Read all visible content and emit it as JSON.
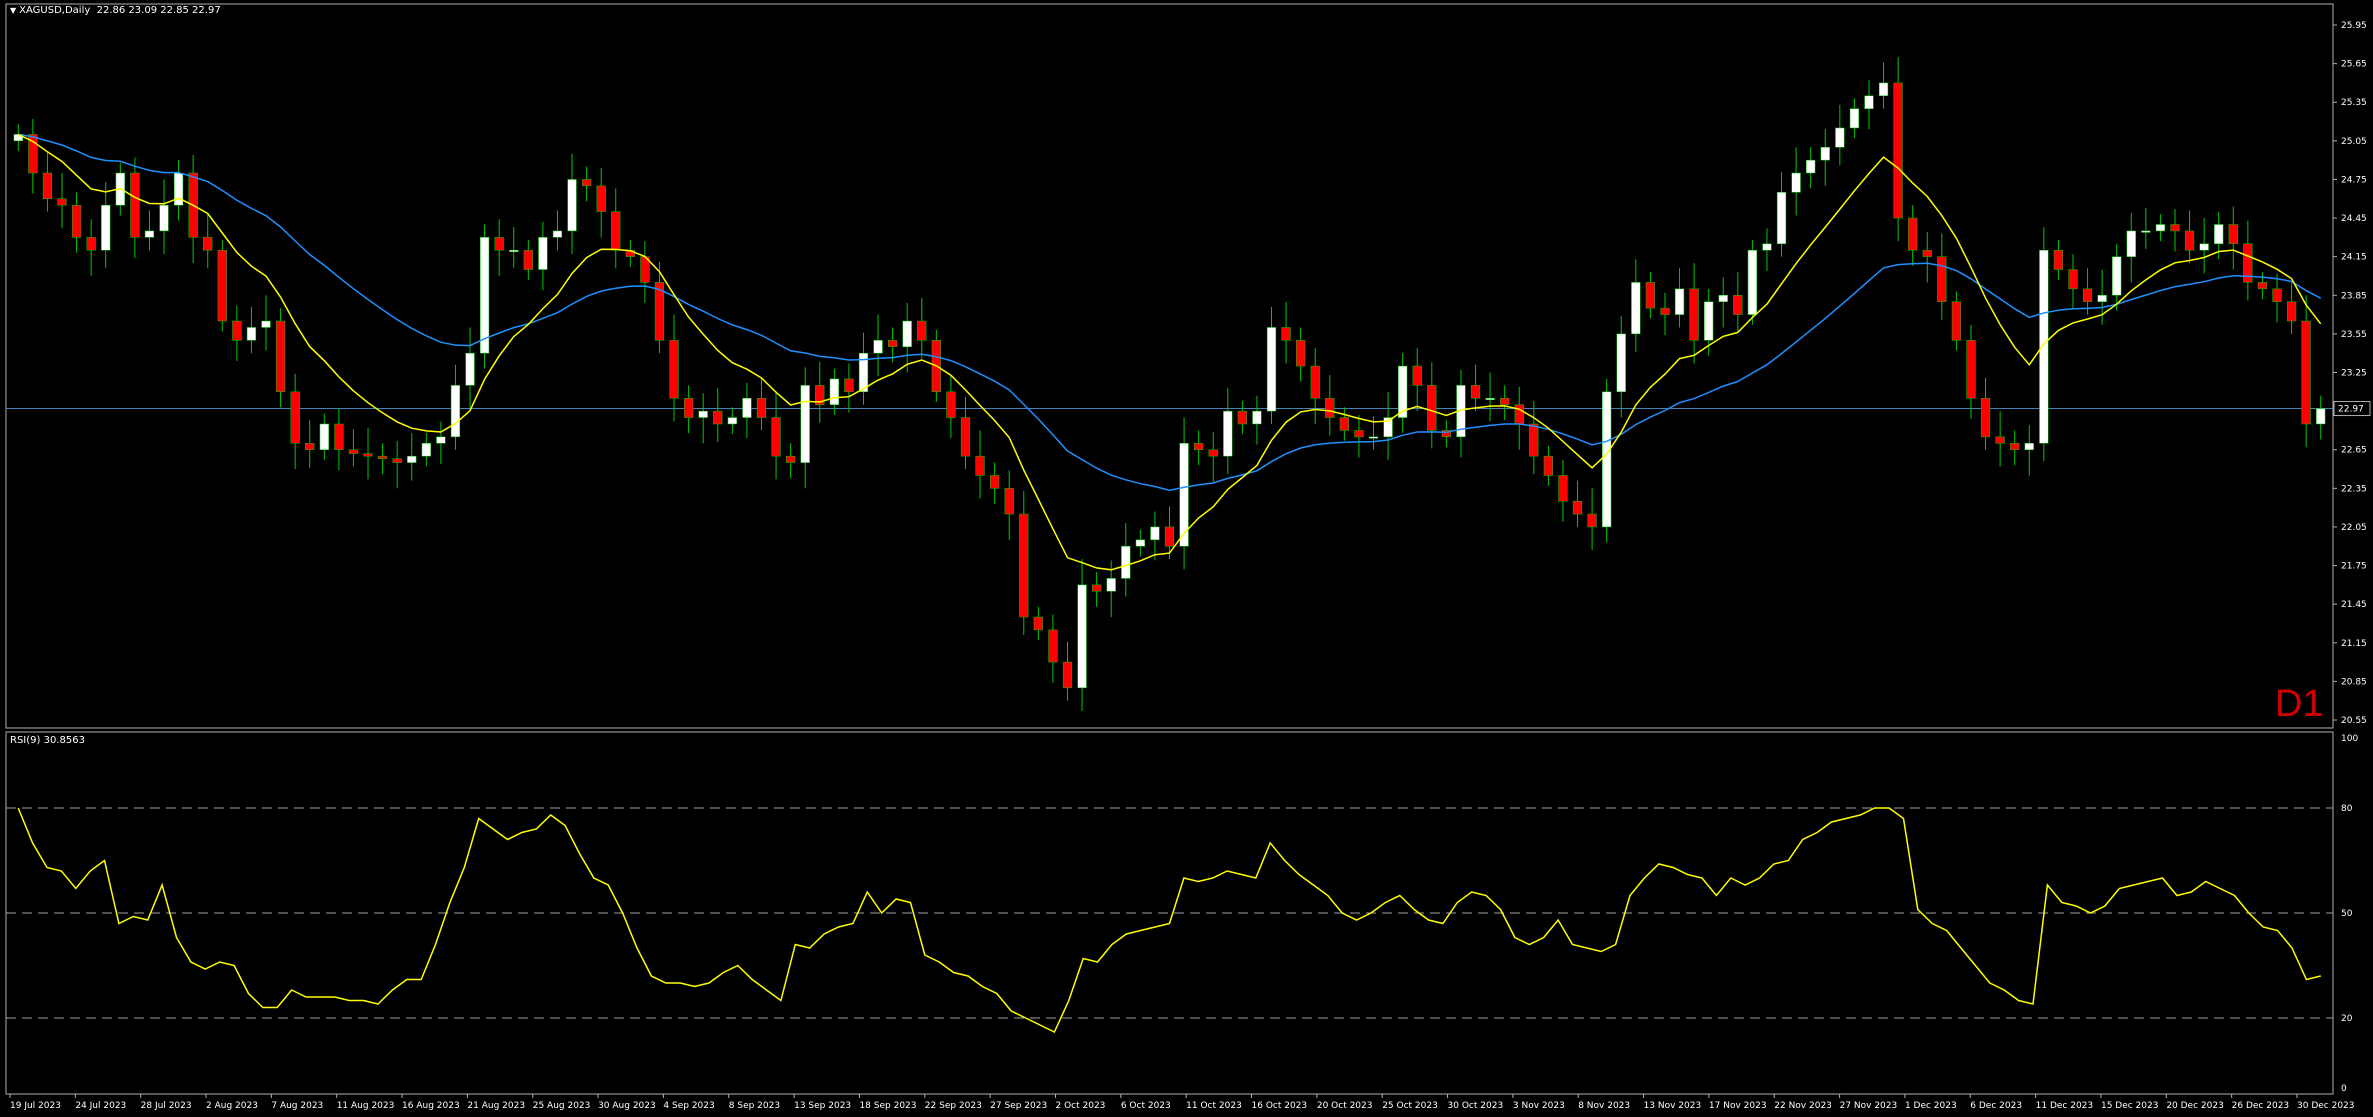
{
  "header": {
    "symbol": "XAGUSD,Daily",
    "ohlc": "22.86 23.09 22.85 22.97"
  },
  "rsi_header": {
    "label": "RSI(9) 30.8563"
  },
  "timeframe": "D1",
  "current_price_label": "22.97",
  "colors": {
    "background": "#000000",
    "bull_candle": "#ffffff",
    "bear_candle": "#ff0000",
    "wick": "#00c800",
    "ma_fast": "#ffff00",
    "ma_slow": "#1e90ff",
    "rsi_line": "#ffff00",
    "price_line": "#4682b4",
    "timeframe_text": "#d00000"
  },
  "chart_data": [
    {
      "type": "candlestick",
      "title": "XAGUSD,Daily",
      "y_ticks": [
        "25.95",
        "25.65",
        "25.35",
        "25.05",
        "24.75",
        "24.45",
        "24.15",
        "23.85",
        "23.55",
        "23.25",
        "22.95",
        "22.65",
        "22.35",
        "22.05",
        "21.75",
        "21.45",
        "21.15",
        "20.85",
        "20.55"
      ],
      "ylim": [
        20.55,
        25.95
      ],
      "x_tick_labels": [
        "19 Jul 2023",
        "24 Jul 2023",
        "28 Jul 2023",
        "2 Aug 2023",
        "7 Aug 2023",
        "11 Aug 2023",
        "16 Aug 2023",
        "21 Aug 2023",
        "25 Aug 2023",
        "30 Aug 2023",
        "4 Sep 2023",
        "8 Sep 2023",
        "13 Sep 2023",
        "18 Sep 2023",
        "22 Sep 2023",
        "27 Sep 2023",
        "2 Oct 2023",
        "6 Oct 2023",
        "11 Oct 2023",
        "16 Oct 2023",
        "20 Oct 2023",
        "25 Oct 2023",
        "30 Oct 2023",
        "3 Nov 2023",
        "8 Nov 2023",
        "13 Nov 2023",
        "17 Nov 2023",
        "22 Nov 2023",
        "27 Nov 2023",
        "1 Dec 2023",
        "6 Dec 2023",
        "11 Dec 2023",
        "15 Dec 2023",
        "20 Dec 2023",
        "26 Dec 2023",
        "30 Dec 2023"
      ],
      "current_price": 22.97,
      "close": [
        25.1,
        24.8,
        24.6,
        24.55,
        24.3,
        24.2,
        24.55,
        24.8,
        24.3,
        24.35,
        24.55,
        24.8,
        24.3,
        24.2,
        23.65,
        23.5,
        23.6,
        23.65,
        23.1,
        22.7,
        22.65,
        22.85,
        22.65,
        22.62,
        22.6,
        22.58,
        22.55,
        22.6,
        22.7,
        22.75,
        23.15,
        23.4,
        24.3,
        24.2,
        24.2,
        24.05,
        24.3,
        24.35,
        24.75,
        24.7,
        24.5,
        24.2,
        24.15,
        23.95,
        23.5,
        23.05,
        22.9,
        22.95,
        22.85,
        22.9,
        23.05,
        22.9,
        22.6,
        22.55,
        23.15,
        23.0,
        23.2,
        23.1,
        23.4,
        23.5,
        23.45,
        23.65,
        23.5,
        23.1,
        22.9,
        22.6,
        22.45,
        22.35,
        22.15,
        21.35,
        21.25,
        21.0,
        20.8,
        21.6,
        21.55,
        21.65,
        21.9,
        21.95,
        22.05,
        21.9,
        22.7,
        22.65,
        22.6,
        22.95,
        22.85,
        22.95,
        23.6,
        23.5,
        23.3,
        23.05,
        22.9,
        22.8,
        22.75,
        22.75,
        22.9,
        23.3,
        23.15,
        22.8,
        22.75,
        23.15,
        23.05,
        23.05,
        23.0,
        22.85,
        22.6,
        22.45,
        22.25,
        22.15,
        22.05,
        23.1,
        23.55,
        23.95,
        23.75,
        23.7,
        23.9,
        23.5,
        23.8,
        23.85,
        23.7,
        24.2,
        24.25,
        24.65,
        24.8,
        24.9,
        25.0,
        25.15,
        25.3,
        25.4,
        25.5,
        24.45,
        24.2,
        24.15,
        23.8,
        23.5,
        23.05,
        22.75,
        22.7,
        22.65,
        22.7,
        24.2,
        24.05,
        23.9,
        23.8,
        23.85,
        24.15,
        24.35,
        24.35,
        24.4,
        24.35,
        24.2,
        24.25,
        24.4,
        24.25,
        23.95,
        23.9,
        23.8,
        23.65,
        22.85,
        22.97
      ],
      "series_overlays": [
        {
          "kind": "moving_average",
          "color": "#ffff00"
        },
        {
          "kind": "moving_average",
          "color": "#1e90ff"
        }
      ]
    },
    {
      "type": "line",
      "title": "RSI(9) 30.8563",
      "y_ticks": [
        "100",
        "80",
        "50",
        "20",
        "0"
      ],
      "ylim": [
        0,
        100
      ],
      "levels": [
        80,
        50,
        20
      ],
      "values": [
        80,
        70,
        63,
        62,
        57,
        62,
        65,
        47,
        49,
        48,
        58,
        43,
        36,
        34,
        36,
        35,
        27,
        23,
        23,
        28,
        26,
        26,
        26,
        25,
        25,
        24,
        28,
        31,
        31,
        41,
        53,
        63,
        77,
        74,
        71,
        73,
        74,
        78,
        75,
        67,
        60,
        58,
        50,
        40,
        32,
        30,
        30,
        29,
        30,
        33,
        35,
        31,
        28,
        25,
        41,
        40,
        44,
        46,
        47,
        56,
        50,
        54,
        53,
        38,
        36,
        33,
        32,
        29,
        27,
        22,
        20,
        18,
        16,
        25,
        37,
        36,
        41,
        44,
        45,
        46,
        47,
        60,
        59,
        60,
        62,
        61,
        60,
        70,
        65,
        61,
        58,
        55,
        50,
        48,
        50,
        53,
        55,
        51,
        48,
        47,
        53,
        56,
        55,
        51,
        43,
        41,
        43,
        48,
        41,
        40,
        39,
        41,
        55,
        60,
        64,
        63,
        61,
        60,
        55,
        60,
        58,
        60,
        64,
        65,
        71,
        73,
        76,
        77,
        78,
        80,
        80,
        77,
        51,
        47,
        45,
        40,
        35,
        30,
        28,
        25,
        24,
        58,
        53,
        52,
        50,
        52,
        57,
        58,
        59,
        60,
        55,
        56,
        59,
        57,
        55,
        50,
        46,
        45,
        40,
        31,
        32
      ]
    }
  ]
}
